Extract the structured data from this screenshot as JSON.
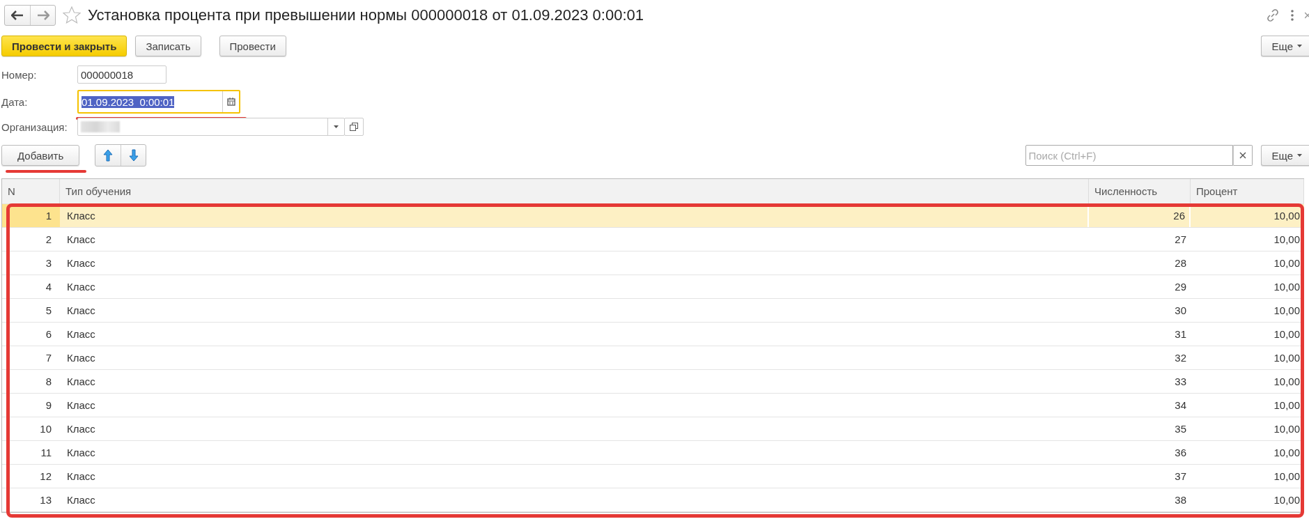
{
  "window": {
    "title": "Установка процента при превышении нормы 000000018 от 01.09.2023 0:00:01",
    "favorite": false
  },
  "toolbar": {
    "buttons": [
      {
        "label": "Провести и закрыть",
        "kind": "primary"
      },
      {
        "label": "Записать",
        "kind": "default"
      },
      {
        "label": "Провести",
        "kind": "default"
      }
    ],
    "more": "Еще"
  },
  "fields": {
    "number": {
      "label": "Номер:",
      "value": "000000018"
    },
    "date": {
      "label": "Дата:",
      "value": "01.09.2023  0:00:01",
      "focused": true
    },
    "organization": {
      "label": "Организация:"
    }
  },
  "table_toolbar": {
    "add": "Добавить",
    "search": {
      "placeholder": "Поиск (Ctrl+F)"
    },
    "more": "Еще"
  },
  "table": {
    "columns": [
      "N",
      "Тип обучения",
      "Численность",
      "Процент"
    ],
    "rows": [
      {
        "n": "1",
        "type": "Класс",
        "count": "26",
        "percent": "10,00",
        "selected": true
      },
      {
        "n": "2",
        "type": "Класс",
        "count": "27",
        "percent": "10,00",
        "selected": false
      },
      {
        "n": "3",
        "type": "Класс",
        "count": "28",
        "percent": "10,00",
        "selected": false
      },
      {
        "n": "4",
        "type": "Класс",
        "count": "29",
        "percent": "10,00",
        "selected": false
      },
      {
        "n": "5",
        "type": "Класс",
        "count": "30",
        "percent": "10,00",
        "selected": false
      },
      {
        "n": "6",
        "type": "Класс",
        "count": "31",
        "percent": "10,00",
        "selected": false
      },
      {
        "n": "7",
        "type": "Класс",
        "count": "32",
        "percent": "10,00",
        "selected": false
      },
      {
        "n": "8",
        "type": "Класс",
        "count": "33",
        "percent": "10,00",
        "selected": false
      },
      {
        "n": "9",
        "type": "Класс",
        "count": "34",
        "percent": "10,00",
        "selected": false
      },
      {
        "n": "10",
        "type": "Класс",
        "count": "35",
        "percent": "10,00",
        "selected": false
      },
      {
        "n": "11",
        "type": "Класс",
        "count": "36",
        "percent": "10,00",
        "selected": false
      },
      {
        "n": "12",
        "type": "Класс",
        "count": "37",
        "percent": "10,00",
        "selected": false
      },
      {
        "n": "13",
        "type": "Класс",
        "count": "38",
        "percent": "10,00",
        "selected": false
      }
    ]
  }
}
